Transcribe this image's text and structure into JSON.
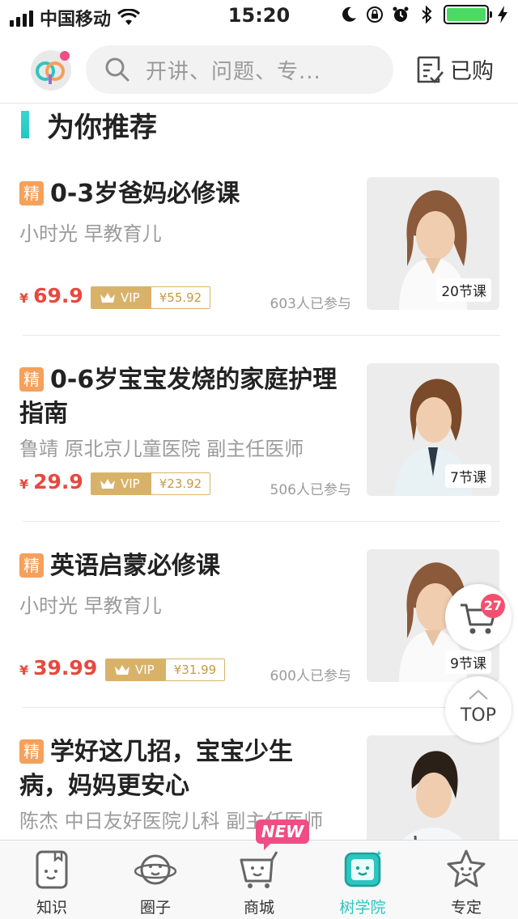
{
  "status_bar": {
    "carrier": "中国移动",
    "time": "15:20"
  },
  "header": {
    "search_placeholder": "开讲、问题、专...",
    "purchased_label": "已购",
    "logo_icon": "app-logo-icon"
  },
  "section": {
    "title": "为你推荐",
    "accent_color": "#2cc6c1"
  },
  "courses": [
    {
      "tag": "精",
      "title": "0-3岁爸妈必修课",
      "author": "小时光 早教育儿",
      "price": "69.9",
      "vip_label": "VIP",
      "vip_price": "¥55.92",
      "participants": "603人已参与",
      "lessons": "20节课"
    },
    {
      "tag": "精",
      "title": "0-6岁宝宝发烧的家庭护理指南",
      "author": "鲁靖 原北京儿童医院 副主任医师",
      "price": "29.9",
      "vip_label": "VIP",
      "vip_price": "¥23.92",
      "participants": "506人已参与",
      "lessons": "7节课"
    },
    {
      "tag": "精",
      "title": "英语启蒙必修课",
      "author": "小时光 早教育儿",
      "price": "39.99",
      "vip_label": "VIP",
      "vip_price": "¥31.99",
      "participants": "600人已参与",
      "lessons": "9节课"
    },
    {
      "tag": "精",
      "title": "学好这几招，宝宝少生病，妈妈更安心",
      "author": "陈杰 中日友好医院儿科 副主任医师",
      "price": "",
      "vip_label": "",
      "vip_price": "",
      "participants": "",
      "lessons": ""
    }
  ],
  "currency_symbol": "¥",
  "floating": {
    "cart_count": "27",
    "top_label": "TOP"
  },
  "tabbar": {
    "items": [
      {
        "label": "知识",
        "icon": "book-face-icon"
      },
      {
        "label": "圈子",
        "icon": "planet-face-icon"
      },
      {
        "label": "商城",
        "icon": "cart-face-icon"
      },
      {
        "label": "树学院",
        "icon": "tv-face-icon",
        "active": true
      },
      {
        "label": "专定",
        "icon": "star-face-icon"
      }
    ],
    "new_badge": "NEW"
  },
  "colors": {
    "price": "#e8483f",
    "vip_gold": "#d9b26a",
    "tag_orange": "#f5a05b",
    "badge_pink": "#f2506e",
    "new_pink": "#f04d84"
  }
}
